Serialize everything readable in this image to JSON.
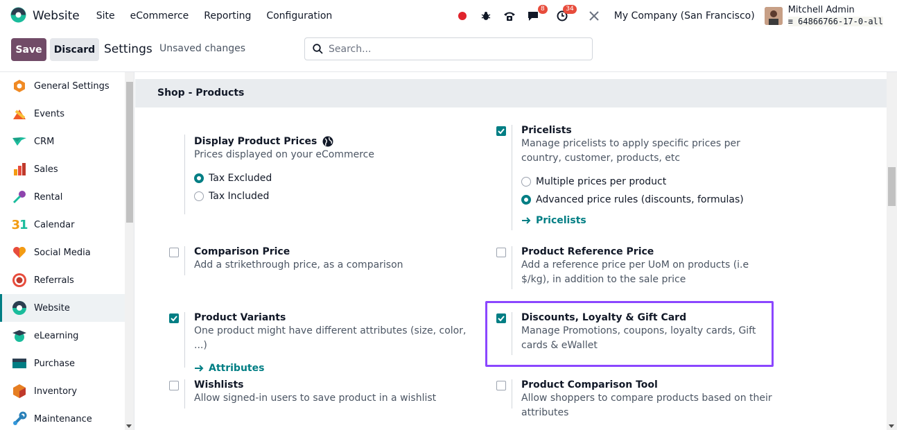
{
  "topbar": {
    "app_name": "Website",
    "menu": [
      "Site",
      "eCommerce",
      "Reporting",
      "Configuration"
    ],
    "badges": {
      "messages": "8",
      "activities": "34"
    },
    "company": "My Company (San Francisco)",
    "user_name": "Mitchell Admin",
    "db_name": "64866766-17-0-all"
  },
  "control": {
    "save_label": "Save",
    "discard_label": "Discard",
    "title": "Settings",
    "unsaved": "Unsaved changes",
    "search_placeholder": "Search..."
  },
  "sidebar": {
    "items": [
      {
        "label": "General Settings",
        "icon": "general-settings-icon",
        "color": "#f08a24"
      },
      {
        "label": "Events",
        "icon": "events-icon",
        "color": "#f05a28"
      },
      {
        "label": "CRM",
        "icon": "crm-icon",
        "color": "#1abc9c"
      },
      {
        "label": "Sales",
        "icon": "sales-icon",
        "color": "#e74c3c"
      },
      {
        "label": "Rental",
        "icon": "rental-icon",
        "color": "#8e44ad"
      },
      {
        "label": "Calendar",
        "icon": "calendar-icon",
        "color": "#f39c12"
      },
      {
        "label": "Social Media",
        "icon": "social-media-icon",
        "color": "#e74c3c"
      },
      {
        "label": "Referrals",
        "icon": "referrals-icon",
        "color": "#e74c3c"
      },
      {
        "label": "Website",
        "icon": "website-icon",
        "color": "#1abc9c"
      },
      {
        "label": "eLearning",
        "icon": "elearning-icon",
        "color": "#1abc9c"
      },
      {
        "label": "Purchase",
        "icon": "purchase-icon",
        "color": "#017e84"
      },
      {
        "label": "Inventory",
        "icon": "inventory-icon",
        "color": "#e67e22"
      },
      {
        "label": "Maintenance",
        "icon": "maintenance-icon",
        "color": "#2980b9"
      }
    ]
  },
  "section": {
    "title": "Shop - Products"
  },
  "settings": {
    "display_prices": {
      "title": "Display Product Prices",
      "desc": "Prices displayed on your eCommerce",
      "options": [
        "Tax Excluded",
        "Tax Included"
      ],
      "selected": "Tax Excluded"
    },
    "pricelists": {
      "title": "Pricelists",
      "desc": "Manage pricelists to apply specific prices per country, customer, products, etc",
      "options": [
        "Multiple prices per product",
        "Advanced price rules (discounts, formulas)"
      ],
      "selected": "Advanced price rules (discounts, formulas)",
      "checked": true,
      "link": "Pricelists"
    },
    "comparison_price": {
      "title": "Comparison Price",
      "desc": "Add a strikethrough price, as a comparison",
      "checked": false
    },
    "reference_price": {
      "title": "Product Reference Price",
      "desc": "Add a reference price per UoM on products (i.e $/kg), in addition to the sale price",
      "checked": false
    },
    "variants": {
      "title": "Product Variants",
      "desc": "One product might have different attributes (size, color, ...)",
      "checked": true,
      "link": "Attributes"
    },
    "loyalty": {
      "title": "Discounts, Loyalty & Gift Card",
      "desc": "Manage Promotions, coupons, loyalty cards, Gift cards & eWallet",
      "checked": true
    },
    "wishlists": {
      "title": "Wishlists",
      "desc": "Allow signed-in users to save product in a wishlist",
      "checked": false
    },
    "comparison_tool": {
      "title": "Product Comparison Tool",
      "desc": "Allow shoppers to compare products based on their attributes",
      "checked": false
    }
  },
  "colors": {
    "accent": "#017e84",
    "primary": "#714b67",
    "highlight": "#8b46ff"
  }
}
